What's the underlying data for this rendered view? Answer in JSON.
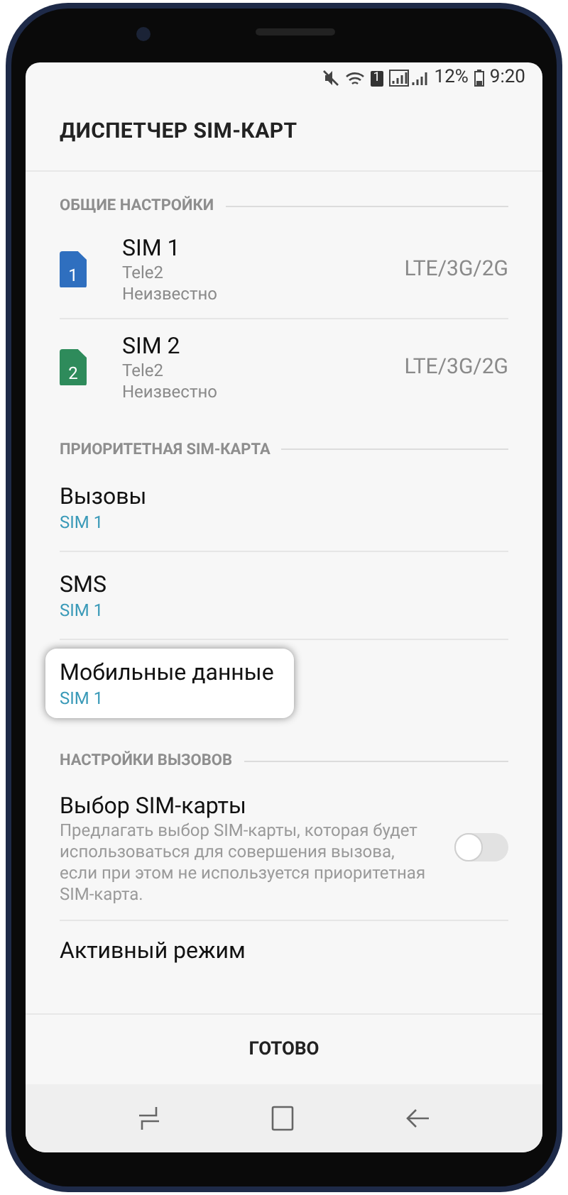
{
  "status_bar": {
    "sim_badge": "1",
    "battery": "12%",
    "time": "9:20"
  },
  "title": "ДИСПЕТЧЕР SIM-КАРТ",
  "sections": [
    {
      "header": "ОБЩИЕ НАСТРОЙКИ",
      "items": [
        {
          "kind": "sim",
          "name": "SIM 1",
          "carrier": "Tele2",
          "status": "Неизвестно",
          "network": "LTE/3G/2G",
          "badge": "1",
          "color": "#2f6fbf"
        },
        {
          "kind": "sim",
          "name": "SIM 2",
          "carrier": "Tele2",
          "status": "Неизвестно",
          "network": "LTE/3G/2G",
          "badge": "2",
          "color": "#2e8b5b"
        }
      ]
    },
    {
      "header": "ПРИОРИТЕТНАЯ SIM-КАРТА",
      "items": [
        {
          "kind": "pref",
          "label": "Вызовы",
          "value": "SIM 1",
          "highlighted": false
        },
        {
          "kind": "pref",
          "label": "SMS",
          "value": "SIM 1",
          "highlighted": false
        },
        {
          "kind": "pref",
          "label": "Мобильные данные",
          "value": "SIM 1",
          "highlighted": true
        }
      ]
    },
    {
      "header": "НАСТРОЙКИ ВЫЗОВОВ",
      "items": [
        {
          "kind": "toggle",
          "label": "Выбор SIM-карты",
          "description": "Предлагать выбор SIM-карты, которая будет использоваться для совершения вызова, если при этом не используется приоритетная SIM-карта.",
          "on": false
        },
        {
          "kind": "plain",
          "label": "Активный режим"
        }
      ]
    }
  ],
  "done_button": "ГОТОВО"
}
